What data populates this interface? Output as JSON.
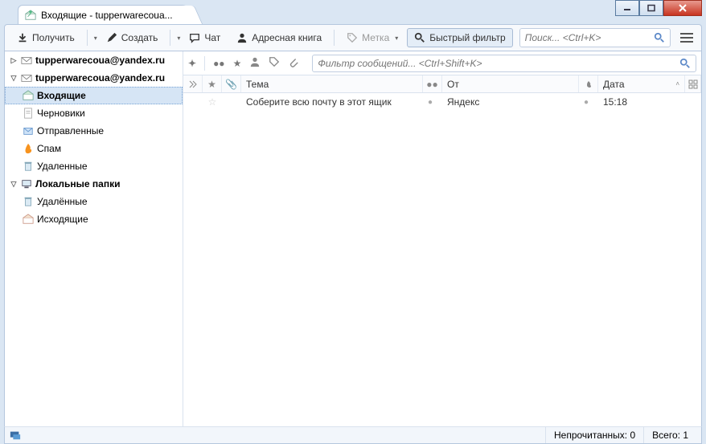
{
  "tab": {
    "title": "Входящие - tupperwarecoua..."
  },
  "toolbar": {
    "get": "Получить",
    "create": "Создать",
    "chat": "Чат",
    "address_book": "Адресная книга",
    "tag": "Метка",
    "quick_filter": "Быстрый фильтр",
    "search_placeholder": "Поиск... <Ctrl+K>"
  },
  "accounts": [
    {
      "label": "tupperwarecoua@yandex.ru",
      "expanded": false
    },
    {
      "label": "tupperwarecoua@yandex.ru",
      "expanded": true
    }
  ],
  "folders": {
    "inbox": "Входящие",
    "drafts": "Черновики",
    "sent": "Отправленные",
    "spam": "Спам",
    "trash": "Удаленные"
  },
  "local": {
    "label": "Локальные папки",
    "trash": "Удалённые",
    "outbox": "Исходящие"
  },
  "filter": {
    "placeholder": "Фильтр сообщений... <Ctrl+Shift+K>"
  },
  "columns": {
    "subject": "Тема",
    "from": "От",
    "date": "Дата"
  },
  "messages": [
    {
      "subject": "Соберите всю почту в этот ящик",
      "from": "Яндекс",
      "date": "15:18"
    }
  ],
  "status": {
    "unread_label": "Непрочитанных:",
    "unread": "0",
    "total_label": "Всего:",
    "total": "1"
  }
}
